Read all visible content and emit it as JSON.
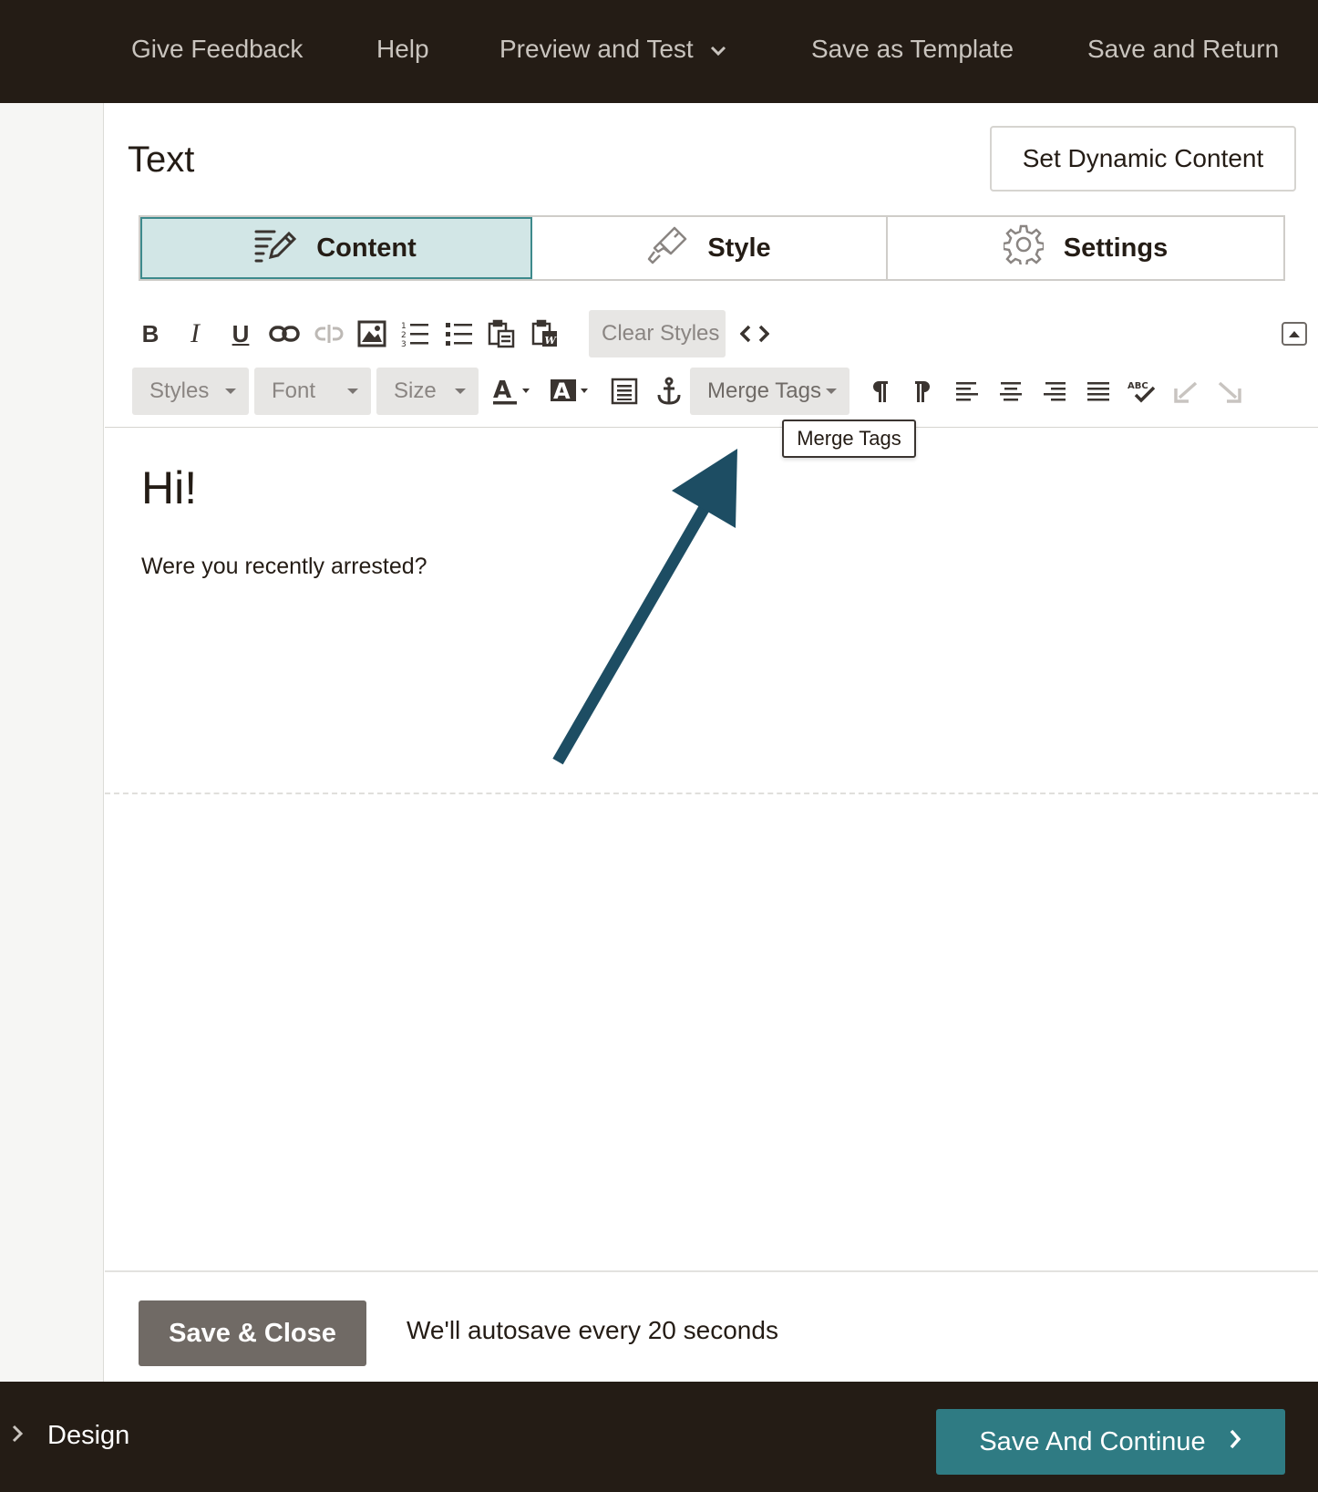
{
  "nav": {
    "give_feedback": "Give Feedback",
    "help": "Help",
    "preview_and_test": "Preview and Test",
    "save_as_template": "Save as Template",
    "save_and_return": "Save and Return"
  },
  "panel": {
    "title": "Text",
    "dynamic_content_button": "Set Dynamic Content",
    "tabs": [
      {
        "label": "Content",
        "icon": "edit-lines-icon",
        "active": true
      },
      {
        "label": "Style",
        "icon": "paint-brush-icon",
        "active": false
      },
      {
        "label": "Settings",
        "icon": "gear-icon",
        "active": false
      }
    ]
  },
  "toolbar": {
    "row1": {
      "bold": "B",
      "italic": "I",
      "underline": "U",
      "clear_styles": "Clear Styles"
    },
    "row2": {
      "styles": "Styles",
      "font": "Font",
      "size": "Size",
      "merge_tags": "Merge Tags"
    },
    "tooltip": "Merge Tags"
  },
  "editor": {
    "heading": "Hi!",
    "paragraph": "Were you recently arrested?"
  },
  "footer": {
    "save_close": "Save & Close",
    "autosave_note": "We'll autosave every 20 seconds"
  },
  "bottombar": {
    "design_label": "Design",
    "save_continue": "Save And Continue"
  },
  "colors": {
    "nav_bg": "#241c15",
    "active_tab_bg": "#d2e6e6",
    "primary_button": "#2f7b83",
    "secondary_button": "#706a65",
    "annotation_arrow": "#1d4d63"
  }
}
